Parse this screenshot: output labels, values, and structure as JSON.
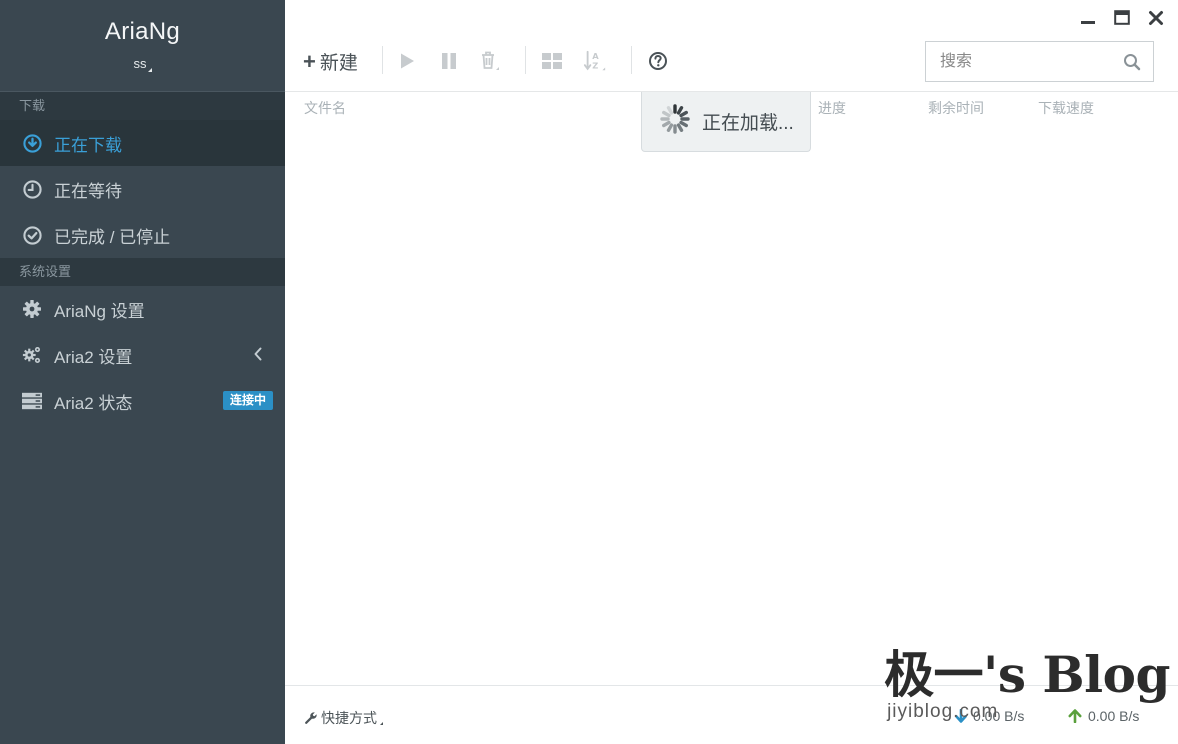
{
  "sidebar": {
    "brand": {
      "title": "AriaNg",
      "subtitle": "ss"
    },
    "sections": {
      "download": "下载",
      "settings": "系统设置"
    },
    "items": [
      {
        "label": "正在下载",
        "icon": "arrow-circle-down-icon",
        "active": true
      },
      {
        "label": "正在等待",
        "icon": "clock-icon"
      },
      {
        "label": "已完成 / 已停止",
        "icon": "check-circle-icon"
      },
      {
        "label": "AriaNg 设置",
        "icon": "gear-icon"
      },
      {
        "label": "Aria2 设置",
        "icon": "gears-icon"
      },
      {
        "label": "Aria2 状态",
        "icon": "server-icon",
        "badge": "连接中"
      }
    ]
  },
  "toolbar": {
    "new_label": "新建",
    "search_placeholder": "搜索"
  },
  "table": {
    "columns": {
      "filename": "文件名",
      "progress": "进度",
      "remaining": "剩余时间",
      "speed": "下载速度"
    }
  },
  "loading": {
    "text": "正在加载..."
  },
  "footer": {
    "shortcut_label": "快捷方式",
    "download_speed": "0.00 B/s",
    "upload_speed": "0.00 B/s"
  },
  "watermark": {
    "title": "极一's Blog",
    "subtitle": "jiyiblog.com"
  },
  "colors": {
    "sidebar_bg": "#3a4750",
    "sidebar_header_bg": "#2d3940",
    "active_item_bg": "#29353b",
    "accent": "#3aa0d8",
    "badge_bg": "#2b90c6",
    "upload_arrow": "#5aa03c",
    "download_arrow": "#2b90c6"
  }
}
